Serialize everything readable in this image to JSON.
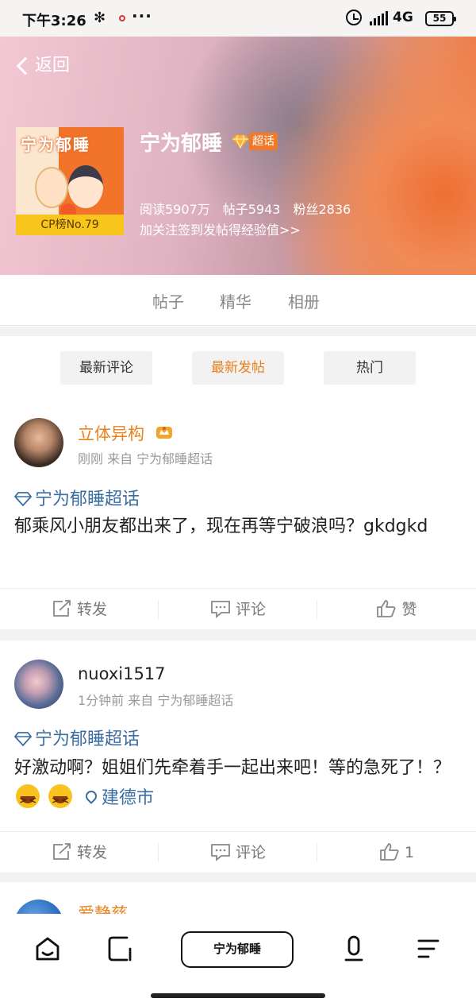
{
  "status_bar": {
    "time": "下午3:26",
    "network": "4G",
    "battery": "55"
  },
  "header": {
    "back_label": "返回",
    "cover_title": "宁为郁睡",
    "rank_label": "CP榜No.79",
    "topic_name": "宁为郁睡",
    "super_badge": "超话",
    "stats": {
      "read": "阅读5907万",
      "posts": "帖子5943",
      "fans": "粉丝2836"
    },
    "hint": "加关注签到发帖得经验值>>"
  },
  "tabs": [
    "帖子",
    "精华",
    "相册"
  ],
  "filters": [
    "最新评论",
    "最新发帖",
    "热门"
  ],
  "posts": [
    {
      "username": "立体异构",
      "meta": "刚刚 来自 宁为郁睡超话",
      "topic": "宁为郁睡超话",
      "text": "郁乘风小朋友都出来了，现在再等宁破浪吗？gkdgkd",
      "actions": {
        "repost": "转发",
        "comment": "评论",
        "like": "赞"
      }
    },
    {
      "username": "nuoxi1517",
      "meta": "1分钟前 来自 宁为郁睡超话",
      "topic": "宁为郁睡超话",
      "text": "好激动啊？姐姐们先牵着手一起出来吧！等的急死了！？",
      "location": "建德市",
      "actions": {
        "repost": "转发",
        "comment": "评论",
        "like": "1"
      }
    },
    {
      "username": "爱静慈"
    }
  ],
  "bottom_bar": {
    "center_label": "宁为郁睡"
  },
  "colors": {
    "accent_orange": "#e8821c",
    "link_blue": "#3b6ea3"
  },
  "icons": [
    "bluetooth-icon",
    "alarm-icon",
    "signal-icon",
    "battery-icon",
    "home-icon",
    "edit-icon",
    "voice-icon",
    "menu-icon",
    "repost-icon",
    "comment-icon",
    "like-icon",
    "diamond-icon",
    "location-icon",
    "crown-icon"
  ]
}
